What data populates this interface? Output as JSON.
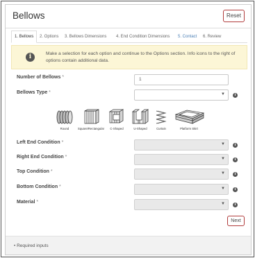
{
  "header": {
    "title": "Bellows",
    "reset_label": "Reset"
  },
  "tabs": [
    {
      "label": "1. Bellows"
    },
    {
      "label": "2. Options"
    },
    {
      "label": "3. Bellows Dimensions"
    },
    {
      "label": "4. End Condition Dimensions"
    },
    {
      "label": "5. Contact"
    },
    {
      "label": "6. Review"
    }
  ],
  "alert": {
    "icon": "info-circle-icon",
    "text": "Make a selection for each option and continue to the Options section. Info icons to the right of options contain additional data."
  },
  "required_marker": "*",
  "fields": {
    "number_of_bellows": {
      "label": "Number of Bellows",
      "value": "1"
    },
    "bellows_type": {
      "label": "Bellows Type",
      "value": ""
    },
    "left_end_condition": {
      "label": "Left End Condition",
      "value": ""
    },
    "right_end_condition": {
      "label": "Right End Condition",
      "value": ""
    },
    "top_condition": {
      "label": "Top Condition",
      "value": ""
    },
    "bottom_condition": {
      "label": "Bottom Condition",
      "value": ""
    },
    "material": {
      "label": "Material",
      "value": ""
    }
  },
  "bellows_types": [
    {
      "label": "Round",
      "icon": "round-bellows-icon"
    },
    {
      "label": "Square/Rectangular",
      "icon": "square-bellows-icon"
    },
    {
      "label": "C-Shaped",
      "icon": "c-shaped-bellows-icon"
    },
    {
      "label": "U-Shaped",
      "icon": "u-shaped-bellows-icon"
    },
    {
      "label": "Curtain",
      "icon": "curtain-bellows-icon"
    },
    {
      "label": "Platform Skirt",
      "icon": "platform-skirt-icon"
    }
  ],
  "next_label": "Next",
  "footer": {
    "text": "• Required inputs"
  }
}
